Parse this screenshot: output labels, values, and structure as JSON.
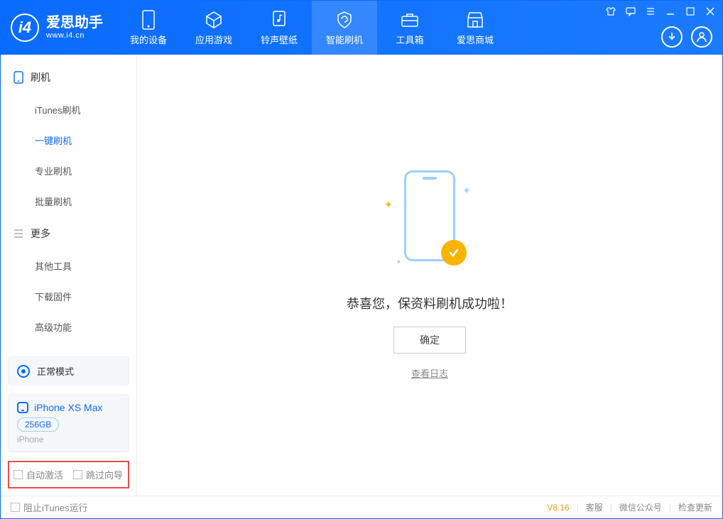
{
  "app": {
    "name": "爱思助手",
    "url": "www.i4.cn"
  },
  "tabs": [
    {
      "label": "我的设备"
    },
    {
      "label": "应用游戏"
    },
    {
      "label": "铃声壁纸"
    },
    {
      "label": "智能刷机"
    },
    {
      "label": "工具箱"
    },
    {
      "label": "爱思商城"
    }
  ],
  "sidebar": {
    "group_flash": "刷机",
    "items_flash": [
      "iTunes刷机",
      "一键刷机",
      "专业刷机",
      "批量刷机"
    ],
    "group_more": "更多",
    "items_more": [
      "其他工具",
      "下载固件",
      "高级功能"
    ]
  },
  "mode": {
    "label": "正常模式"
  },
  "device": {
    "name": "iPhone XS Max",
    "storage": "256GB",
    "type": "iPhone"
  },
  "options": {
    "auto_activate": "自动激活",
    "skip_guide": "跳过向导"
  },
  "main": {
    "success": "恭喜您，保资料刷机成功啦！",
    "confirm": "确定",
    "view_log": "查看日志"
  },
  "status": {
    "block_itunes": "阻止iTunes运行",
    "version": "V8.16",
    "links": [
      "客服",
      "微信公众号",
      "检查更新"
    ]
  }
}
